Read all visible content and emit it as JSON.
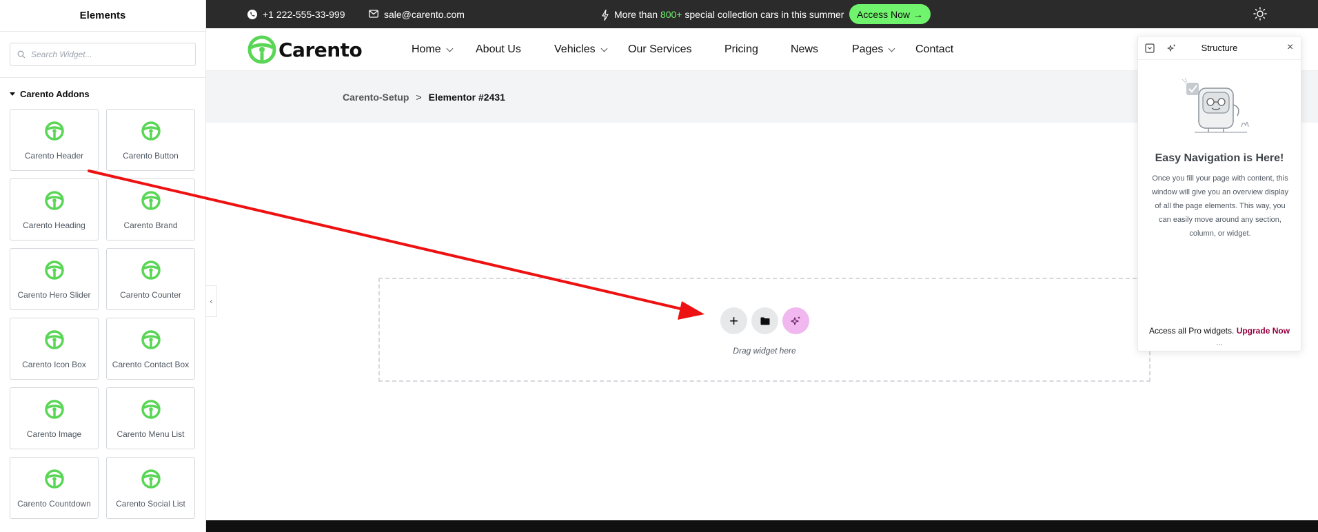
{
  "panel": {
    "title": "Elements",
    "search_placeholder": "Search Widget...",
    "category": "Carento Addons",
    "widgets": [
      {
        "label": "Carento Header"
      },
      {
        "label": "Carento Button"
      },
      {
        "label": "Carento Heading"
      },
      {
        "label": "Carento Brand"
      },
      {
        "label": "Carento Hero Slider"
      },
      {
        "label": "Carento Counter"
      },
      {
        "label": "Carento Icon Box"
      },
      {
        "label": "Carento Contact Box"
      },
      {
        "label": "Carento Image"
      },
      {
        "label": "Carento Menu List"
      },
      {
        "label": "Carento Countdown"
      },
      {
        "label": "Carento Social List"
      }
    ],
    "collapse_glyph": "‹"
  },
  "topbar": {
    "phone": "+1 222-555-33-999",
    "email": "sale@carento.com",
    "promo_before": "More than ",
    "promo_highlight": "800+",
    "promo_after": " special collection cars in this summer",
    "access_label": "Access Now",
    "access_arrow": "→"
  },
  "nav": {
    "logo_text": "Carento",
    "items": [
      {
        "label": "Home"
      },
      {
        "label": "About Us"
      },
      {
        "label": "Vehicles"
      },
      {
        "label": "Our Services"
      },
      {
        "label": "Pricing"
      },
      {
        "label": "News"
      },
      {
        "label": "Pages"
      },
      {
        "label": "Contact"
      }
    ]
  },
  "breadcrumb": {
    "parent": "Carento-Setup",
    "separator": ">",
    "current": "Elementor #2431"
  },
  "dropzone": {
    "hint": "Drag widget here",
    "add_glyph": "+"
  },
  "structure": {
    "title": "Structure",
    "heading": "Easy Navigation is Here!",
    "body": "Once you fill your page with content, this window will give you an overview display of all the page elements. This way, you can easily move around any section, column, or widget.",
    "promo": "Access all Pro widgets.",
    "upgrade": "Upgrade Now",
    "dots": "...",
    "close_glyph": "×"
  },
  "colors": {
    "accent_green": "#70f46d",
    "topbar_bg": "#2b2b2b",
    "ai_pink": "#f0b8ee",
    "annotation_arrow": "#ee1111",
    "upgrade_link": "#93003f"
  },
  "icons": [
    "search-icon",
    "steering-wheel-icon",
    "phone-icon",
    "mail-icon",
    "bolt-icon",
    "sun-icon",
    "plus-icon",
    "folder-icon",
    "sparkle-icon",
    "close-icon"
  ]
}
